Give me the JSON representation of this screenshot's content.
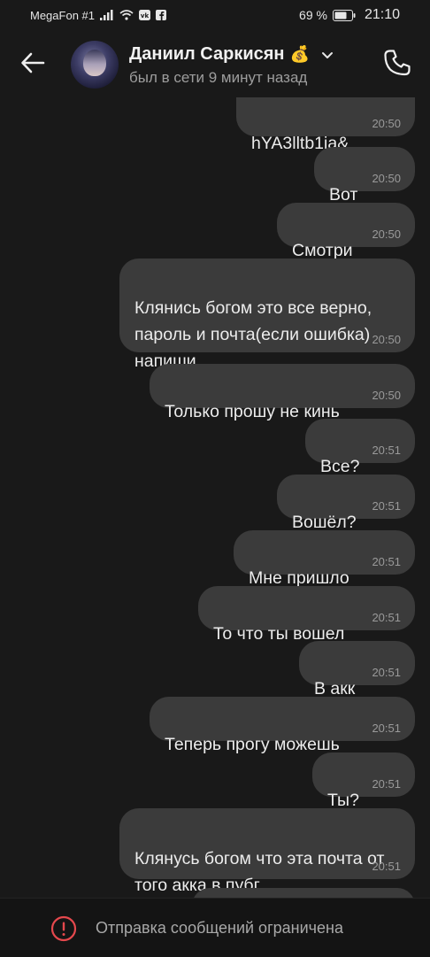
{
  "status_bar": {
    "carrier": "MegaFon #1",
    "battery": "69 %",
    "time": "21:10"
  },
  "header": {
    "contact_name": "Даниил Саркисян",
    "name_emoji": "💰",
    "last_seen": "был в сети 9 минут назад"
  },
  "messages": [
    {
      "text": "hYA3lltb1ia&",
      "time": "20:50"
    },
    {
      "text": "Вот",
      "time": "20:50"
    },
    {
      "text": "Смотри",
      "time": "20:50"
    },
    {
      "text": "Клянись богом это все верно,\nпароль и почта(если ошибка)\nнапиши",
      "time": "20:50"
    },
    {
      "text": "Только прошу не кинь",
      "time": "20:50"
    },
    {
      "text": "Все?",
      "time": "20:51"
    },
    {
      "text": "Вошёл?",
      "time": "20:51"
    },
    {
      "text": "Мне пришло",
      "time": "20:51"
    },
    {
      "text": "То что ты вошел",
      "time": "20:51"
    },
    {
      "text": "В акк",
      "time": "20:51"
    },
    {
      "text": "Теперь прогу можешь",
      "time": "20:51"
    },
    {
      "text": "Ты?",
      "time": "20:51"
    },
    {
      "text": "Клянусь богом что эта почта от\nтого акка в пубг",
      "time": "20:51"
    }
  ],
  "footer": {
    "restriction_text": "Отправка сообщений ограничена"
  }
}
